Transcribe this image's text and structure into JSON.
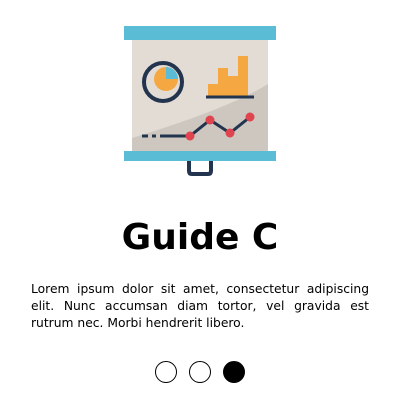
{
  "colors": {
    "accent_blue": "#5bbcd6",
    "board": "#e2dcd4",
    "board_shadow": "#cdc7bf",
    "navy": "#23344f",
    "orange": "#f5a841",
    "red": "#e0444f"
  },
  "illustration": {
    "icon": "presentation-board-icon"
  },
  "guide": {
    "title": "Guide C",
    "body": "Lorem ipsum dolor sit amet, consectetur adipiscing elit. Nunc accumsan diam tortor, vel gravida est rutrum nec. Morbi hendrerit libero."
  },
  "pager": {
    "pages": 3,
    "active_index": 2
  }
}
